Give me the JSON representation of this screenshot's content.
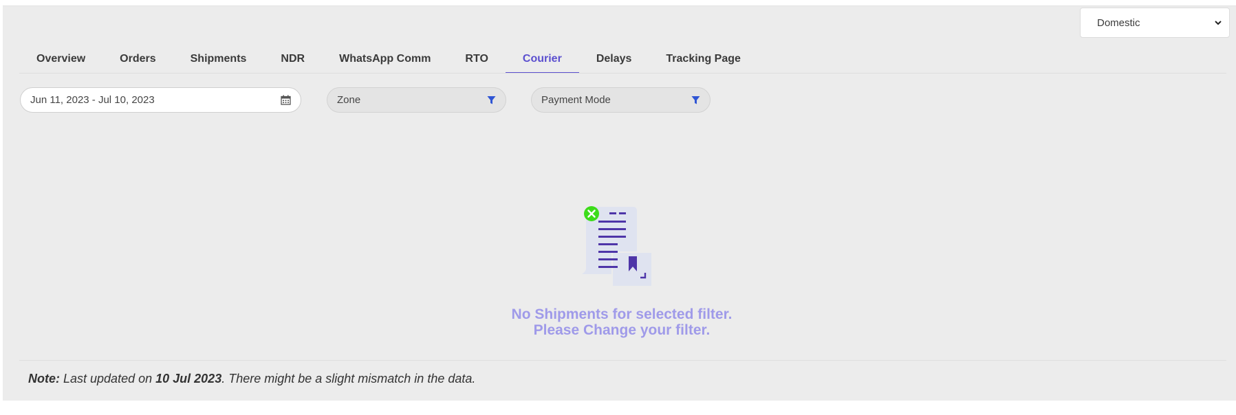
{
  "region_select": {
    "value": "Domestic"
  },
  "tabs": [
    {
      "label": "Overview"
    },
    {
      "label": "Orders"
    },
    {
      "label": "Shipments"
    },
    {
      "label": "NDR"
    },
    {
      "label": "WhatsApp Comm"
    },
    {
      "label": "RTO"
    },
    {
      "label": "Courier",
      "active": true
    },
    {
      "label": "Delays"
    },
    {
      "label": "Tracking Page"
    }
  ],
  "filters": {
    "date_range": "Jun 11, 2023 - Jul 10, 2023",
    "zone_placeholder": "Zone",
    "payment_placeholder": "Payment Mode"
  },
  "empty_state": {
    "line1": "No Shipments for selected filter.",
    "line2": "Please Change your filter."
  },
  "note": {
    "label": "Note:",
    "text_before": " Last updated on ",
    "date": "10 Jul 2023",
    "text_after": ". There might be a slight mismatch in the data."
  },
  "colors": {
    "accent": "#5b4fcf",
    "empty_text": "#9f9ae9",
    "filter_icon": "#2f55d4",
    "error_badge": "#3ddc1a"
  },
  "icons": {
    "calendar": "calendar-icon",
    "filter": "filter-icon",
    "dropdown": "chevron-down-icon"
  }
}
